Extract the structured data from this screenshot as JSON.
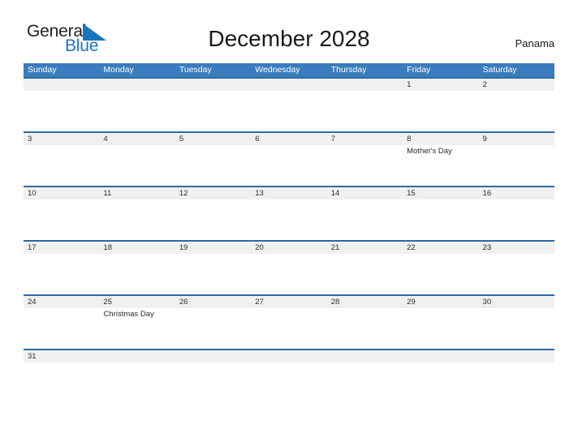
{
  "brand": {
    "name_part1": "General",
    "name_part2": "Blue",
    "flag_icon": "blue-flag-triangle-icon",
    "color_dark": "#231f20",
    "color_blue": "#1b75bc"
  },
  "header": {
    "title": "December 2028",
    "country": "Panama"
  },
  "theme": {
    "header_blue": "#3a7cbd",
    "row_border_blue": "#2c6ca4",
    "date_band_gray": "#f0f0f0",
    "text_color": "#2b2b2b"
  },
  "calendar": {
    "weekdays": [
      "Sunday",
      "Monday",
      "Tuesday",
      "Wednesday",
      "Thursday",
      "Friday",
      "Saturday"
    ],
    "weeks": [
      [
        {
          "day": "",
          "event": ""
        },
        {
          "day": "",
          "event": ""
        },
        {
          "day": "",
          "event": ""
        },
        {
          "day": "",
          "event": ""
        },
        {
          "day": "",
          "event": ""
        },
        {
          "day": "1",
          "event": ""
        },
        {
          "day": "2",
          "event": ""
        }
      ],
      [
        {
          "day": "3",
          "event": ""
        },
        {
          "day": "4",
          "event": ""
        },
        {
          "day": "5",
          "event": ""
        },
        {
          "day": "6",
          "event": ""
        },
        {
          "day": "7",
          "event": ""
        },
        {
          "day": "8",
          "event": "Mother's Day"
        },
        {
          "day": "9",
          "event": ""
        }
      ],
      [
        {
          "day": "10",
          "event": ""
        },
        {
          "day": "11",
          "event": ""
        },
        {
          "day": "12",
          "event": ""
        },
        {
          "day": "13",
          "event": ""
        },
        {
          "day": "14",
          "event": ""
        },
        {
          "day": "15",
          "event": ""
        },
        {
          "day": "16",
          "event": ""
        }
      ],
      [
        {
          "day": "17",
          "event": ""
        },
        {
          "day": "18",
          "event": ""
        },
        {
          "day": "19",
          "event": ""
        },
        {
          "day": "20",
          "event": ""
        },
        {
          "day": "21",
          "event": ""
        },
        {
          "day": "22",
          "event": ""
        },
        {
          "day": "23",
          "event": ""
        }
      ],
      [
        {
          "day": "24",
          "event": ""
        },
        {
          "day": "25",
          "event": "Christmas Day"
        },
        {
          "day": "26",
          "event": ""
        },
        {
          "day": "27",
          "event": ""
        },
        {
          "day": "28",
          "event": ""
        },
        {
          "day": "29",
          "event": ""
        },
        {
          "day": "30",
          "event": ""
        }
      ],
      [
        {
          "day": "31",
          "event": ""
        },
        {
          "day": "",
          "event": ""
        },
        {
          "day": "",
          "event": ""
        },
        {
          "day": "",
          "event": ""
        },
        {
          "day": "",
          "event": ""
        },
        {
          "day": "",
          "event": ""
        },
        {
          "day": "",
          "event": ""
        }
      ]
    ]
  }
}
